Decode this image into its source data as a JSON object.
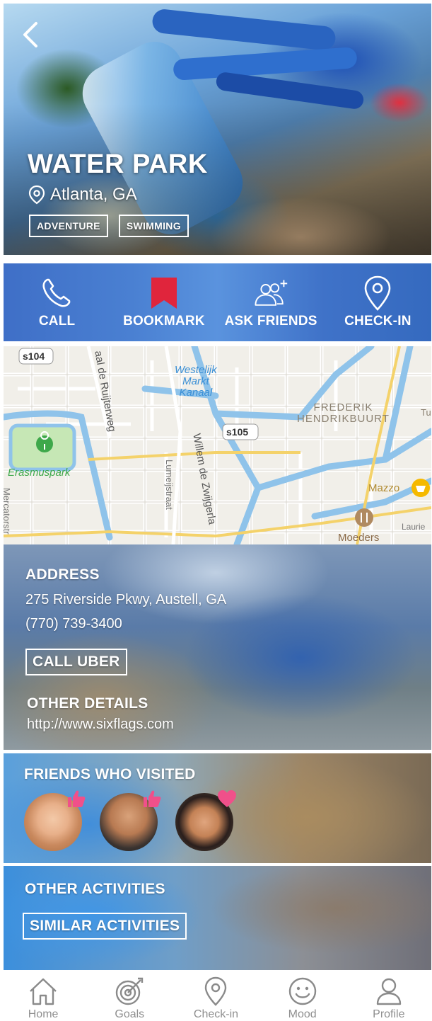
{
  "hero": {
    "title": "WATER PARK",
    "location": "Atlanta, GA",
    "tags": [
      "ADVENTURE",
      "SWIMMING"
    ]
  },
  "actions": [
    {
      "label": "CALL",
      "icon": "phone-icon"
    },
    {
      "label": "BOOKMARK",
      "icon": "bookmark-icon"
    },
    {
      "label": "ASK FRIENDS",
      "icon": "ask-friends-icon"
    },
    {
      "label": "CHECK-IN",
      "icon": "map-pin-icon"
    }
  ],
  "map": {
    "labels": {
      "road1": "s104",
      "road2": "s105",
      "canal": "Westelijk\nMarkt\nKanaal",
      "district": "FREDERIK\nHENDRIKBUURT",
      "park": "Erasmuspark",
      "street1": "aal de Ruijterweg",
      "street2": "Willem de Zwijgerla",
      "street3": "Lumeijstraat",
      "street4": "Mercatorstr",
      "poi1": "Mazzo",
      "poi2": "Moeders",
      "street5": "Laurie",
      "edge": "Tu"
    }
  },
  "info": {
    "address_heading": "ADDRESS",
    "address": "275 Riverside Pkwy, Austell, GA",
    "phone": "(770) 739-3400",
    "call_uber": "CALL UBER",
    "other_heading": "OTHER DETAILS",
    "website": "http://www.sixflags.com"
  },
  "friends": {
    "heading": "FRIENDS WHO VISITED",
    "reactions": [
      "thumbs-up-icon",
      "thumbs-up-icon",
      "heart-icon"
    ]
  },
  "other": {
    "heading": "OTHER ACTIVITIES",
    "button": "SIMILAR ACTIVITIES"
  },
  "nav": [
    {
      "label": "Home",
      "icon": "home-icon"
    },
    {
      "label": "Goals",
      "icon": "target-icon"
    },
    {
      "label": "Check-in",
      "icon": "map-pin-icon"
    },
    {
      "label": "Mood",
      "icon": "smiley-icon"
    },
    {
      "label": "Profile",
      "icon": "profile-icon"
    }
  ],
  "colors": {
    "action_bar": "#4a80d2",
    "bookmark": "#e0253c",
    "badge": "#f0508a",
    "nav_text": "#8f8f8f"
  }
}
